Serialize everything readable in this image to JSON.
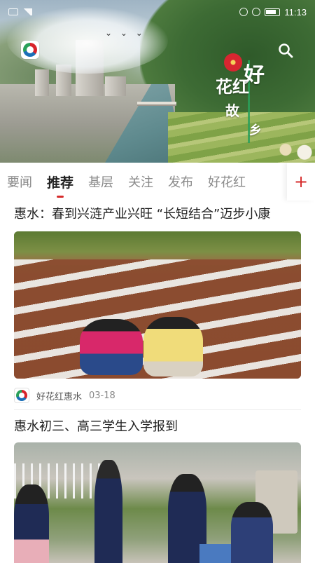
{
  "status_bar": {
    "time": "11:13"
  },
  "banner": {
    "brand_text_line1": "好",
    "brand_text_line2": "花红",
    "brand_text_line3": "故",
    "brand_text_line4": "乡"
  },
  "tabs": [
    {
      "label": "要闻",
      "active": false
    },
    {
      "label": "推荐",
      "active": true
    },
    {
      "label": "基层",
      "active": false
    },
    {
      "label": "关注",
      "active": false
    },
    {
      "label": "发布",
      "active": false
    },
    {
      "label": "好花红",
      "active": false
    }
  ],
  "add_tab_label": "+",
  "articles": [
    {
      "title": "惠水：春到兴涟产业兴旺 “长短结合”迈步小康",
      "source": "好花红惠水",
      "date": "03-18"
    },
    {
      "title": "惠水初三、高三学生入学报到"
    }
  ],
  "colors": {
    "accent": "#d62c2c",
    "text_primary": "#1e1e1e",
    "text_muted": "#8a8a8a"
  }
}
